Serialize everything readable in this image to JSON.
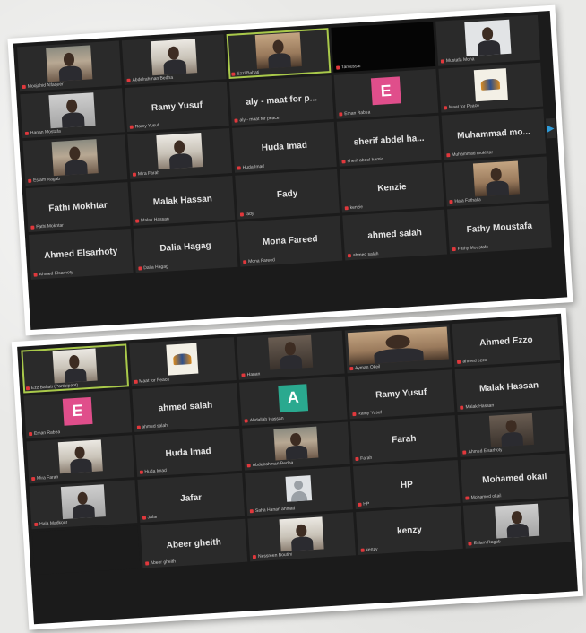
{
  "screenshot1": {
    "tiles": [
      {
        "kind": "video",
        "style": "v-room",
        "caption": "Moojahid Alfaqeer"
      },
      {
        "kind": "video",
        "style": "v-light",
        "caption": "Abdelrahman Bedha"
      },
      {
        "kind": "video",
        "style": "v-warm",
        "caption": "Ezzl Bahati",
        "active": true
      },
      {
        "kind": "black",
        "caption": "Taroussar"
      },
      {
        "kind": "video",
        "style": "v-pale",
        "caption": "Mustafa Moha"
      },
      {
        "kind": "video",
        "style": "v-gray",
        "caption": "Hanan Mostafa"
      },
      {
        "kind": "name",
        "name": "Ramy Yusuf",
        "caption": "Ramy Yusuf"
      },
      {
        "kind": "name",
        "name": "aly - maat for p...",
        "caption": "aly - maat for peace"
      },
      {
        "kind": "avatar",
        "letter": "E",
        "color": "pink",
        "caption": "Eman Rabea"
      },
      {
        "kind": "logo",
        "caption": "Maat for Peace"
      },
      {
        "kind": "video",
        "style": "v-room",
        "caption": "Eslam Ragab"
      },
      {
        "kind": "video",
        "style": "v-light",
        "caption": "Mira Farah"
      },
      {
        "kind": "name",
        "name": "Huda Imad",
        "caption": "Huda Imad"
      },
      {
        "kind": "name",
        "name": "sherif abdel ha...",
        "caption": "sherif abdel hamid"
      },
      {
        "kind": "name",
        "name": "Muhammad mo...",
        "caption": "Muhammad mokhtar"
      },
      {
        "kind": "name",
        "name": "Fathi Mokhtar",
        "caption": "Fathi Mokhtar"
      },
      {
        "kind": "name",
        "name": "Malak Hassan",
        "caption": "Malak Hassan"
      },
      {
        "kind": "name",
        "name": "Fady",
        "caption": "fady"
      },
      {
        "kind": "name",
        "name": "Kenzie",
        "caption": "kenzie"
      },
      {
        "kind": "video",
        "style": "v-warm",
        "caption": "Hala Fathalla"
      },
      {
        "kind": "name",
        "name": "Ahmed Elsarhoty",
        "caption": "Ahmed Elsarhoty"
      },
      {
        "kind": "name",
        "name": "Dalia Hagag",
        "caption": "Dalia Hagag"
      },
      {
        "kind": "name",
        "name": "Mona Fareed",
        "caption": "Mona Fareed"
      },
      {
        "kind": "name",
        "name": "ahmed salah",
        "caption": "ahmed salah"
      },
      {
        "kind": "name",
        "name": "Fathy Moustafa",
        "caption": "Fathy Moustafa"
      }
    ]
  },
  "screenshot2": {
    "tiles": [
      {
        "kind": "video",
        "style": "v-light",
        "caption": "Ezz Bahati (Participant)",
        "active": true
      },
      {
        "kind": "logo",
        "caption": "Maat for Peace"
      },
      {
        "kind": "video",
        "style": "v-dark",
        "caption": "Hanan"
      },
      {
        "kind": "video",
        "style": "v-warm",
        "caption": "Ayman Okeil",
        "wide": true
      },
      {
        "kind": "name",
        "name": "Ahmed Ezzo",
        "caption": "ahmed ezzo"
      },
      {
        "kind": "avatar",
        "letter": "E",
        "color": "pink",
        "caption": "Eman Rabea"
      },
      {
        "kind": "name",
        "name": "ahmed salah",
        "caption": "ahmed salah"
      },
      {
        "kind": "avatar",
        "letter": "A",
        "color": "teal",
        "caption": "Abdallah Hassan"
      },
      {
        "kind": "name",
        "name": "Ramy Yusuf",
        "caption": "Ramy Yusuf"
      },
      {
        "kind": "name",
        "name": "Malak Hassan",
        "caption": "Malak Hassan"
      },
      {
        "kind": "video",
        "style": "v-light",
        "caption": "Mira Farah"
      },
      {
        "kind": "name",
        "name": "Huda Imad",
        "caption": "Huda Imad"
      },
      {
        "kind": "video",
        "style": "v-room",
        "caption": "Abdelrahman Bedha"
      },
      {
        "kind": "name",
        "name": "Farah",
        "caption": "Farah"
      },
      {
        "kind": "video",
        "style": "v-dark",
        "caption": "Ahmed Elsarhoty"
      },
      {
        "kind": "video",
        "style": "v-gray",
        "caption": "Hala Madkour"
      },
      {
        "kind": "name",
        "name": "Jafar",
        "caption": "Jafar"
      },
      {
        "kind": "placeholder",
        "caption": "Saha Hanan ahmad"
      },
      {
        "kind": "name",
        "name": "HP",
        "caption": "HP"
      },
      {
        "kind": "name",
        "name": "Mohamed okail",
        "caption": "Mohamed okail"
      },
      {
        "kind": "empty"
      },
      {
        "kind": "name",
        "name": "Abeer gheith",
        "caption": "Abeer gheith"
      },
      {
        "kind": "video",
        "style": "v-light",
        "caption": "Nessreen Boutini"
      },
      {
        "kind": "name",
        "name": "kenzy",
        "caption": "kenzy"
      },
      {
        "kind": "video",
        "style": "v-gray",
        "caption": "Eslam Ragab"
      }
    ]
  }
}
